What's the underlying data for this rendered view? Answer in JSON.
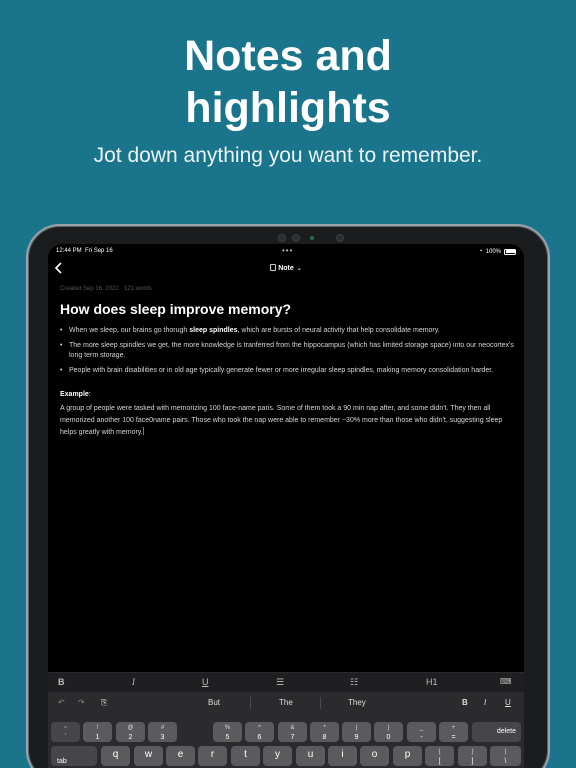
{
  "headline": {
    "line1": "Notes and",
    "line2": "highlights"
  },
  "subhead": "Jot down anything you want to remember.",
  "status": {
    "time": "12:44 PM",
    "date": "Fri Sep 16",
    "battery": "100%"
  },
  "nav": {
    "title": "Note"
  },
  "note": {
    "meta": "Created Sep 16, 2022 · 121 words",
    "heading": "How does sleep improve memory?",
    "bullets": [
      {
        "pre": "When we sleep, our brains go thorugh ",
        "bold": "sleep spindles",
        "post": ", which are bursts of neural activity that help consolidate memory."
      },
      {
        "text": "The more sleep spindles we get, the more knowledge is tranferred from the hippocampus (which has limited storage space) into our neocortex's long term storage."
      },
      {
        "text": "People with brain disabilities or in old age typically generate fewer or more irregular sleep spindles, making memory consolidation harder."
      }
    ],
    "example_label": "Example",
    "example_colon": ":",
    "example_text": "A group of people were tasked with memorizing 100 face-name paris. Some of them took a 90 min nap after, and some didn't. They then all memorized another 100 face0name pairs. Those who took the nap were able to remember ~30% more than those who didn't, suggesting sleep helps greatly with memory."
  },
  "toolbar": {
    "bold": "B",
    "italic": "I",
    "underline": "U",
    "heading": "H1"
  },
  "suggestions": {
    "s1": "But",
    "s2": "The",
    "s3": "They",
    "b": "B",
    "i": "I",
    "u": "U"
  },
  "keyboard": {
    "row1": [
      {
        "top": "~",
        "main": "`"
      },
      {
        "top": "!",
        "main": "1"
      },
      {
        "top": "@",
        "main": "2"
      },
      {
        "top": "#",
        "main": "3"
      },
      {
        "top": "%",
        "main": "5"
      },
      {
        "top": "^",
        "main": "6"
      },
      {
        "top": "&",
        "main": "7"
      },
      {
        "top": "*",
        "main": "8"
      },
      {
        "top": "(",
        "main": "9"
      },
      {
        "top": ")",
        "main": "0"
      },
      {
        "top": "_",
        "main": "-"
      },
      {
        "top": "+",
        "main": "="
      }
    ],
    "delete": "delete",
    "tab": "tab",
    "row2": [
      "q",
      "w",
      "e",
      "r",
      "t",
      "y",
      "u",
      "i",
      "o",
      "p"
    ],
    "brace_open": {
      "top": "{",
      "main": "["
    },
    "brace_close": {
      "top": "}",
      "main": "]"
    },
    "pipe": {
      "top": "|",
      "main": "\\"
    }
  },
  "colors": {
    "background": "#1a758c",
    "screen": "#000000",
    "cursor": "#3a7bff"
  }
}
